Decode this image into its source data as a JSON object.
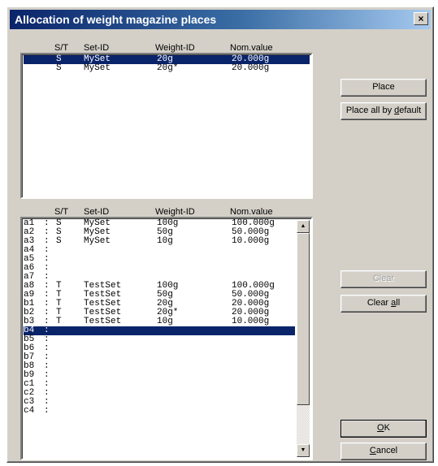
{
  "window": {
    "title": "Allocation of weight magazine places",
    "close_label": "×"
  },
  "columns": {
    "st": "S/T",
    "setid": "Set-ID",
    "weightid": "Weight-ID",
    "nom": "Nom.value"
  },
  "upper_list": [
    {
      "st": "S",
      "setid": "MySet",
      "weightid": "20g",
      "nom": "20.000g",
      "selected": true
    },
    {
      "st": "S",
      "setid": "MySet",
      "weightid": "20g*",
      "nom": "20.000g",
      "selected": false
    }
  ],
  "lower_list": [
    {
      "place": "a1",
      "st": "S",
      "setid": "MySet",
      "weightid": "100g",
      "nom": "100.000g"
    },
    {
      "place": "a2",
      "st": "S",
      "setid": "MySet",
      "weightid": "50g",
      "nom": "50.000g"
    },
    {
      "place": "a3",
      "st": "S",
      "setid": "MySet",
      "weightid": "10g",
      "nom": "10.000g"
    },
    {
      "place": "a4",
      "st": "",
      "setid": "",
      "weightid": "",
      "nom": ""
    },
    {
      "place": "a5",
      "st": "",
      "setid": "",
      "weightid": "",
      "nom": ""
    },
    {
      "place": "a6",
      "st": "",
      "setid": "",
      "weightid": "",
      "nom": ""
    },
    {
      "place": "a7",
      "st": "",
      "setid": "",
      "weightid": "",
      "nom": ""
    },
    {
      "place": "a8",
      "st": "T",
      "setid": "TestSet",
      "weightid": "100g",
      "nom": "100.000g"
    },
    {
      "place": "a9",
      "st": "T",
      "setid": "TestSet",
      "weightid": "50g",
      "nom": "50.000g"
    },
    {
      "place": "b1",
      "st": "T",
      "setid": "TestSet",
      "weightid": "20g",
      "nom": "20.000g"
    },
    {
      "place": "b2",
      "st": "T",
      "setid": "TestSet",
      "weightid": "20g*",
      "nom": "20.000g"
    },
    {
      "place": "b3",
      "st": "T",
      "setid": "TestSet",
      "weightid": "10g",
      "nom": "10.000g"
    },
    {
      "place": "b4",
      "st": "",
      "setid": "",
      "weightid": "",
      "nom": "",
      "selected": true
    },
    {
      "place": "b5",
      "st": "",
      "setid": "",
      "weightid": "",
      "nom": ""
    },
    {
      "place": "b6",
      "st": "",
      "setid": "",
      "weightid": "",
      "nom": ""
    },
    {
      "place": "b7",
      "st": "",
      "setid": "",
      "weightid": "",
      "nom": ""
    },
    {
      "place": "b8",
      "st": "",
      "setid": "",
      "weightid": "",
      "nom": ""
    },
    {
      "place": "b9",
      "st": "",
      "setid": "",
      "weightid": "",
      "nom": ""
    },
    {
      "place": "c1",
      "st": "",
      "setid": "",
      "weightid": "",
      "nom": ""
    },
    {
      "place": "c2",
      "st": "",
      "setid": "",
      "weightid": "",
      "nom": ""
    },
    {
      "place": "c3",
      "st": "",
      "setid": "",
      "weightid": "",
      "nom": ""
    },
    {
      "place": "c4",
      "st": "",
      "setid": "",
      "weightid": "",
      "nom": ""
    }
  ],
  "buttons": {
    "place": "Place",
    "place_all_pre": "Place all by ",
    "place_all_key": "d",
    "place_all_post": "efault",
    "clear": "Clear",
    "clear_all_pre": "Clear ",
    "clear_all_key": "a",
    "clear_all_post": "ll",
    "ok_key": "O",
    "ok_post": "K",
    "cancel_key": "C",
    "cancel_post": "ancel"
  },
  "scrollbar": {
    "up_icon": "arrow-up-icon",
    "down_icon": "arrow-down-icon"
  },
  "colors": {
    "titlebar": "#0a246a",
    "selection": "#0a246a",
    "face": "#d4d0c8"
  }
}
